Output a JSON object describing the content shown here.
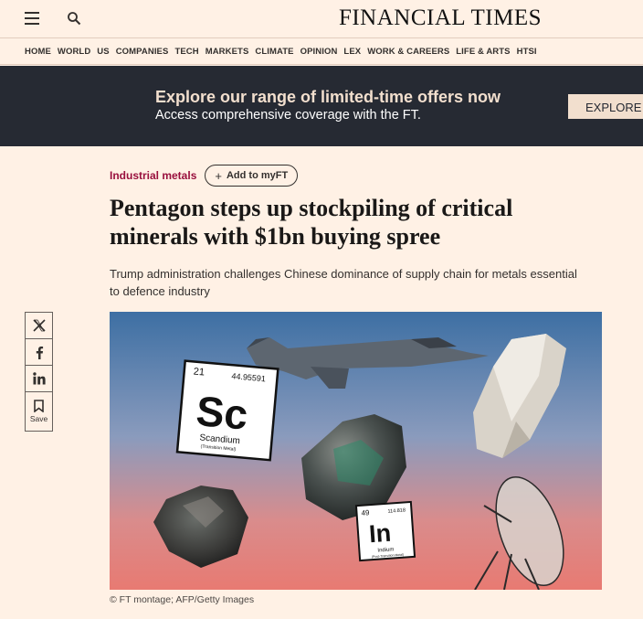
{
  "header": {
    "brand": "FINANCIAL TIMES",
    "menu_icon": "hamburger-menu-icon",
    "search_icon": "search-icon"
  },
  "nav": {
    "items": [
      "HOME",
      "WORLD",
      "US",
      "COMPANIES",
      "TECH",
      "MARKETS",
      "CLIMATE",
      "OPINION",
      "LEX",
      "WORK & CAREERS",
      "LIFE & ARTS",
      "HTSI"
    ]
  },
  "promo": {
    "title": "Explore our range of limited-time offers now",
    "subtitle": "Access comprehensive coverage with the FT.",
    "button": "EXPLORE OFFERS"
  },
  "article": {
    "topic": "Industrial metals",
    "add_myft": "Add to myFT",
    "headline": "Pentagon steps up stockpiling of critical minerals with $1bn buying spree",
    "standfirst": "Trump administration challenges Chinese dominance of supply chain for metals essential to defence industry",
    "caption": "© FT montage; AFP/Getty Images"
  },
  "share": {
    "save_label": "Save",
    "icons": [
      "x-logo-icon",
      "facebook-icon",
      "linkedin-icon",
      "bookmark-icon"
    ]
  },
  "hero_image": {
    "tile_sc": {
      "number": "21",
      "mass": "44.95591",
      "symbol": "Sc",
      "name": "Scandium",
      "category": "(Transition Metal)"
    },
    "tile_in": {
      "number": "49",
      "mass": "114.818",
      "symbol": "In",
      "name": "Indium",
      "category": "(Post-Transition Metal)"
    }
  },
  "colors": {
    "page_bg": "#fff1e5",
    "promo_bg": "#262a33",
    "promo_title": "#f2dfce",
    "topic": "#990f3d"
  }
}
